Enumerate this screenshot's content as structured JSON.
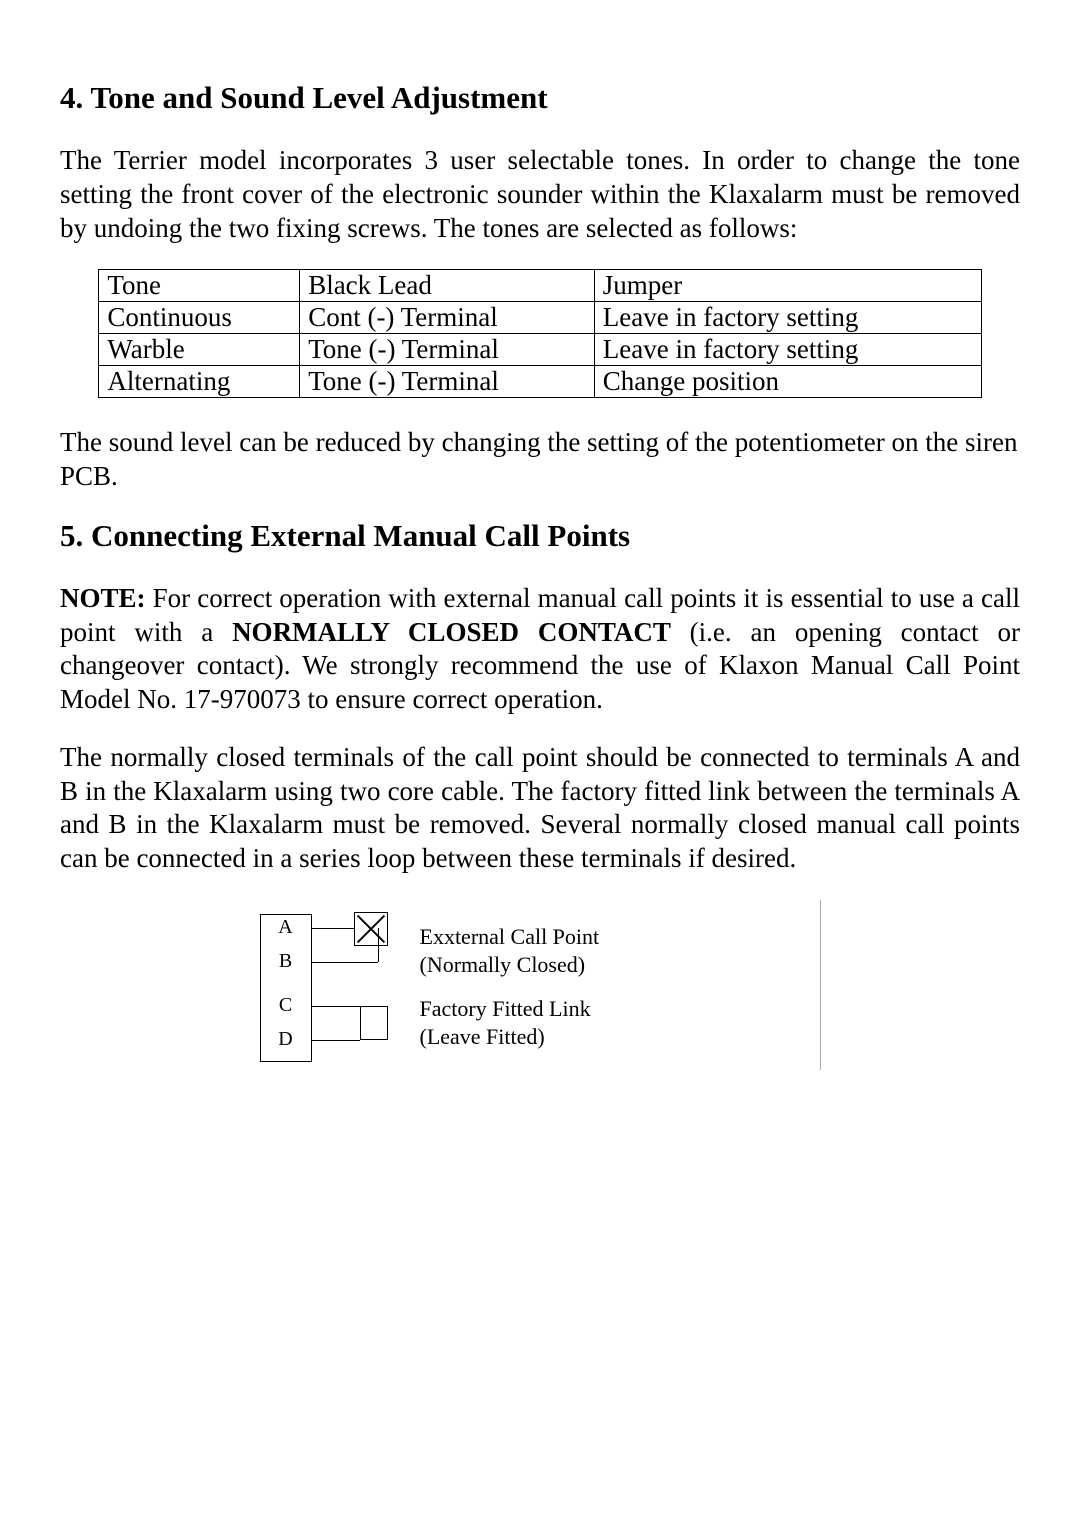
{
  "section4": {
    "heading": "4. Tone and Sound Level Adjustment",
    "intro": "The Terrier model incorporates 3 user selectable tones. In order to change the tone setting the front cover of the electronic sounder within the Klaxalarm must be removed by undoing the two fixing screws. The tones are selected as follows:",
    "table": {
      "header": {
        "c1": "Tone",
        "c2": "Black Lead",
        "c3": "Jumper"
      },
      "rows": [
        {
          "c1": "Continuous",
          "c2": "Cont (-) Terminal",
          "c3": "Leave in factory setting"
        },
        {
          "c1": "Warble",
          "c2": "Tone (-) Terminal",
          "c3": "Leave in factory setting"
        },
        {
          "c1": "Alternating",
          "c2": "Tone (-) Terminal",
          "c3": "Change position"
        }
      ]
    },
    "outro": "The sound level can be reduced by changing the setting of the potentiometer on the siren PCB."
  },
  "section5": {
    "heading": "5. Connecting External Manual Call Points",
    "note_label": "NOTE:",
    "note_before": " For correct operation with external manual call points it is essential to use a call point with a ",
    "note_bold": "NORMALLY CLOSED CONTACT",
    "note_after": " (i.e. an opening contact or changeover contact). We strongly recommend the use of Klaxon Manual Call Point Model No. 17-970073 to ensure correct operation.",
    "para2": "The normally closed terminals of the call point should be connected to terminals A and B in the Klaxalarm using two core cable. The factory fitted link between the terminals A and B in the Klaxalarm must be removed. Several normally closed manual call points can be connected in a series loop between these terminals if desired.",
    "diagram": {
      "terms": {
        "a": "A",
        "b": "B",
        "c": "C",
        "d": "D"
      },
      "label1a": "Exxternal Call Point",
      "label1b": "(Normally Closed)",
      "label2a": "Factory Fitted Link",
      "label2b": "(Leave Fitted)"
    }
  }
}
